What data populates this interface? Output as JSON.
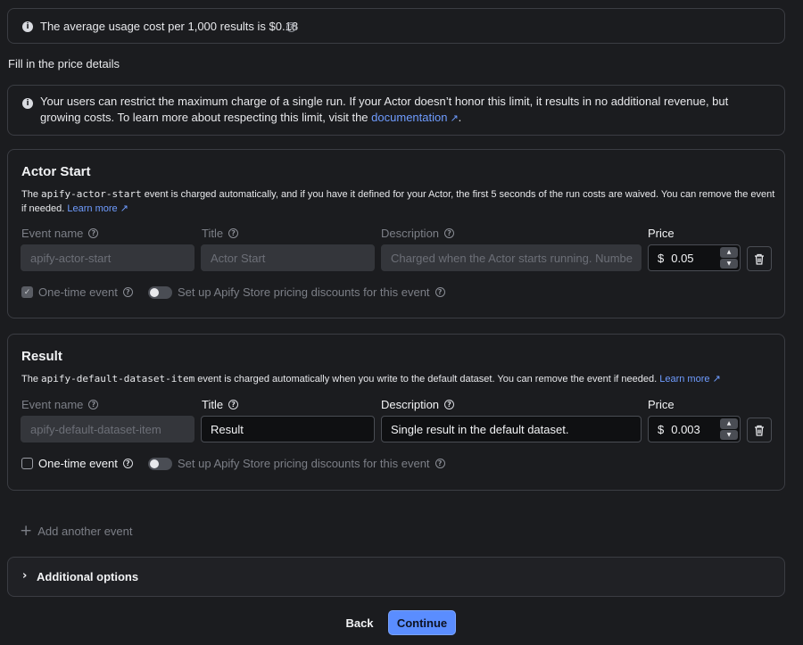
{
  "notice": {
    "text": "The average usage cost per 1,000 results is $0.18"
  },
  "form_heading": "Fill in the price details",
  "limit_notice": {
    "text": "Your users can restrict the maximum charge of a single run. If your Actor doesn’t honor this limit, it results in no additional revenue, but growing costs. To learn more about respecting this limit, visit the",
    "link": "documentation",
    "suffix": "."
  },
  "labels": {
    "event_name": "Event name",
    "title": "Title",
    "description": "Description",
    "price": "Price",
    "one_time": "One-time event",
    "discounts": "Set up Apify Store pricing discounts for this event",
    "currency": "$"
  },
  "events": [
    {
      "heading": "Actor Start",
      "desc_prefix": "The",
      "code": "apify-actor-start",
      "desc_rest": "event is charged automatically, and if you have it defined for your Actor, the first 5 seconds of the run costs are waived. You can remove the event if needed.",
      "learn_more": "Learn more",
      "event_name_value": "apify-actor-start",
      "title_value": "Actor Start",
      "description_value": "Charged when the Actor starts running. Numbe",
      "price_value": "0.05",
      "one_time_checked": true,
      "fields_disabled": true
    },
    {
      "heading": "Result",
      "desc_prefix": "The",
      "code": "apify-default-dataset-item",
      "desc_rest": "event is charged automatically when you write to the default dataset. You can remove the event if needed.",
      "learn_more": "Learn more",
      "event_name_value": "apify-default-dataset-item",
      "title_value": "Result",
      "description_value": "Single result in the default dataset.",
      "price_value": "0.003",
      "one_time_checked": false,
      "fields_disabled": false
    }
  ],
  "add_event": "Add another event",
  "additional_options": "Additional options",
  "buttons": {
    "back": "Back",
    "continue": "Continue"
  },
  "colors": {
    "background": "#1b1c1f",
    "accent": "#5a8dff",
    "link": "#6f9cff",
    "border": "#3b3d43"
  }
}
